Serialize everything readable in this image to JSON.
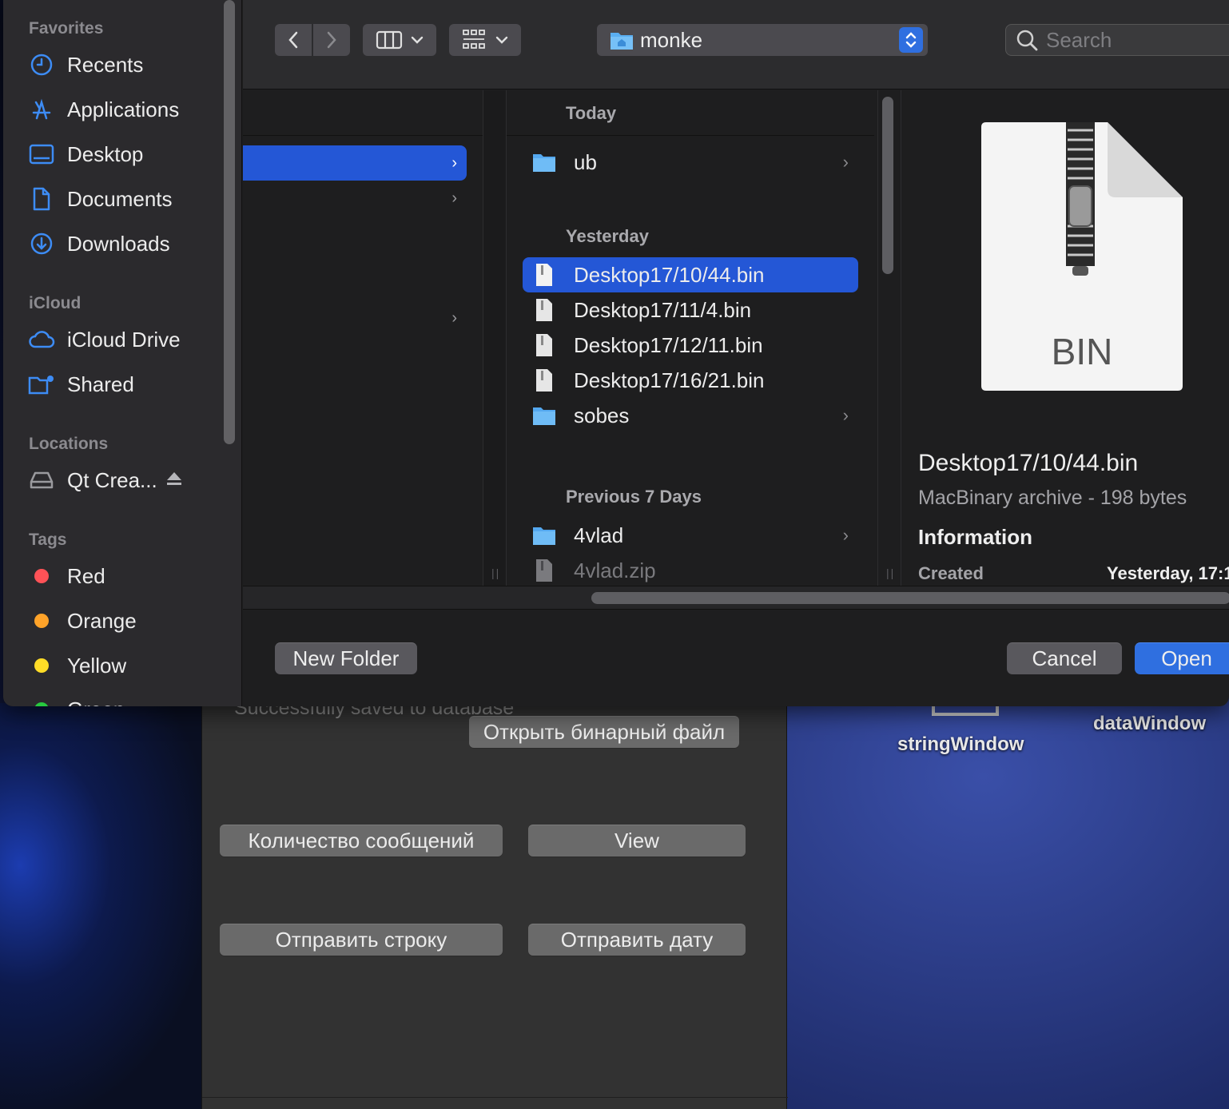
{
  "sidebar": {
    "favorites_heading": "Favorites",
    "favorites": [
      {
        "label": "Recents",
        "icon": "clock-icon"
      },
      {
        "label": "Applications",
        "icon": "applications-icon"
      },
      {
        "label": "Desktop",
        "icon": "desktop-icon"
      },
      {
        "label": "Documents",
        "icon": "document-icon"
      },
      {
        "label": "Downloads",
        "icon": "download-icon"
      }
    ],
    "icloud_heading": "iCloud",
    "icloud": [
      {
        "label": "iCloud Drive",
        "icon": "cloud-icon"
      },
      {
        "label": "Shared",
        "icon": "shared-folder-icon"
      }
    ],
    "locations_heading": "Locations",
    "locations": [
      {
        "label": "Qt Crea...",
        "icon": "drive-icon"
      }
    ],
    "tags_heading": "Tags",
    "tags": [
      {
        "label": "Red",
        "color": "#ff5257"
      },
      {
        "label": "Orange",
        "color": "#ffa329"
      },
      {
        "label": "Yellow",
        "color": "#ffdc27"
      },
      {
        "label": "Green",
        "color": "#27c93f"
      }
    ]
  },
  "toolbar": {
    "path_name": "monke",
    "search_placeholder": "Search"
  },
  "browser": {
    "groups": {
      "today": "Today",
      "yesterday": "Yesterday",
      "previous7": "Previous 7 Days"
    },
    "files": {
      "ub": "ub",
      "f1": "Desktop17/10/44.bin",
      "f2": "Desktop17/11/4.bin",
      "f3": "Desktop17/12/11.bin",
      "f4": "Desktop17/16/21.bin",
      "sobes": "sobes",
      "vlad": "4vlad",
      "vladzip": "4vlad.zip"
    }
  },
  "preview": {
    "icon_text": "BIN",
    "title": "Desktop17/10/44.bin",
    "subtitle": "MacBinary archive - 198 bytes",
    "info_heading": "Information",
    "created_label": "Created",
    "created_value": "Yesterday, 17:1"
  },
  "footer": {
    "new_folder": "New Folder",
    "cancel": "Cancel",
    "open": "Open"
  },
  "qt_app": {
    "status": "Successfully saved to database",
    "open_binary": "Открыть бинарный файл",
    "msg_count": "Количество сообщений",
    "view": "View",
    "send_string": "Отправить строку",
    "send_date": "Отправить дату"
  },
  "desktop": {
    "string_window": "stringWindow",
    "data_window": "dataWindow"
  }
}
